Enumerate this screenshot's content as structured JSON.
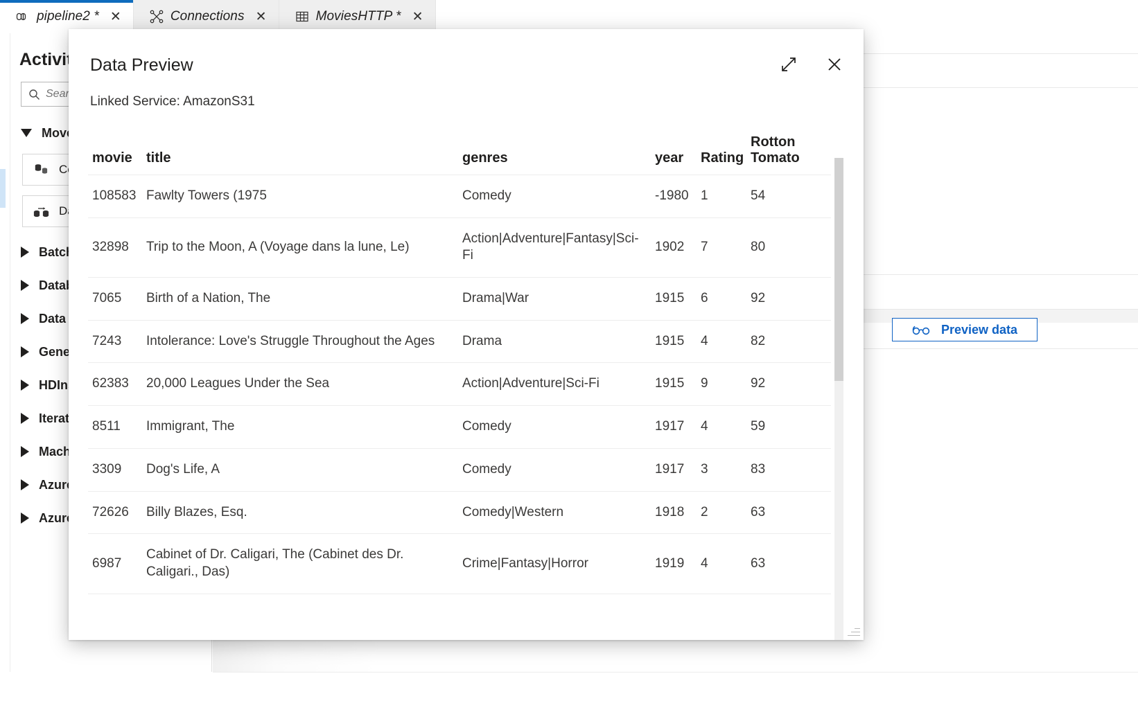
{
  "tabs": [
    {
      "label": "pipeline2 *",
      "icon": "pipeline-icon",
      "close": "✕",
      "active": true
    },
    {
      "label": "Connections",
      "icon": "connections-icon",
      "close": "✕",
      "active": false
    },
    {
      "label": "MoviesHTTP *",
      "icon": "table-icon",
      "close": "✕",
      "active": false
    }
  ],
  "left_pane": {
    "title": "Activities",
    "search": {
      "placeholder": "Search activities",
      "icon": "search-icon"
    },
    "groups": [
      {
        "label": "Move & transform",
        "expanded": true
      },
      {
        "label": "Batch Service",
        "expanded": false
      },
      {
        "label": "Databricks",
        "expanded": false
      },
      {
        "label": "Data Lake Analytics",
        "expanded": false
      },
      {
        "label": "General",
        "expanded": false
      },
      {
        "label": "HDInsight",
        "expanded": false
      },
      {
        "label": "Iteration & conditionals",
        "expanded": false
      },
      {
        "label": "Machine Learning",
        "expanded": false
      },
      {
        "label": "Azure Data Explorer",
        "expanded": false
      },
      {
        "label": "Azure Synapse Analytics",
        "expanded": false
      }
    ],
    "activities": [
      {
        "label": "Copy data",
        "icon": "copy-data-icon"
      },
      {
        "label": "Data flow",
        "icon": "data-flow-icon"
      }
    ]
  },
  "canvas": {
    "preview_button": {
      "label": "Preview data",
      "icon": "glasses-icon",
      "color": "#0f62c4"
    }
  },
  "dialog": {
    "title": "Data Preview",
    "subtitle": "Linked Service: AmazonS31",
    "expand_icon": "expand-diagonal-icon",
    "close_icon": "close-icon",
    "columns": [
      "movie",
      "title",
      "genres",
      "year",
      "Rating",
      "Rotton Tomato"
    ],
    "rows": [
      {
        "movie": "108583",
        "title": "Fawlty Towers (1975",
        "genres": "Comedy",
        "year": "-1980",
        "rating": "1",
        "rotton_tomato": "54"
      },
      {
        "movie": "32898",
        "title": "Trip to the Moon, A (Voyage dans la lune, Le)",
        "genres": "Action|Adventure|Fantasy|Sci-Fi",
        "year": "1902",
        "rating": "7",
        "rotton_tomato": "80"
      },
      {
        "movie": "7065",
        "title": "Birth of a Nation, The",
        "genres": "Drama|War",
        "year": "1915",
        "rating": "6",
        "rotton_tomato": "92"
      },
      {
        "movie": "7243",
        "title": "Intolerance: Love's Struggle Throughout the Ages",
        "genres": "Drama",
        "year": "1915",
        "rating": "4",
        "rotton_tomato": "82"
      },
      {
        "movie": "62383",
        "title": "20,000 Leagues Under the Sea",
        "genres": "Action|Adventure|Sci-Fi",
        "year": "1915",
        "rating": "9",
        "rotton_tomato": "92"
      },
      {
        "movie": "8511",
        "title": "Immigrant, The",
        "genres": "Comedy",
        "year": "1917",
        "rating": "4",
        "rotton_tomato": "59"
      },
      {
        "movie": "3309",
        "title": "Dog's Life, A",
        "genres": "Comedy",
        "year": "1917",
        "rating": "3",
        "rotton_tomato": "83"
      },
      {
        "movie": "72626",
        "title": "Billy Blazes, Esq.",
        "genres": "Comedy|Western",
        "year": "1918",
        "rating": "2",
        "rotton_tomato": "63"
      },
      {
        "movie": "6987",
        "title": "Cabinet of Dr. Caligari, The (Cabinet des Dr. Caligari., Das)",
        "genres": "Crime|Fantasy|Horror",
        "year": "1919",
        "rating": "4",
        "rotton_tomato": "63"
      }
    ]
  }
}
